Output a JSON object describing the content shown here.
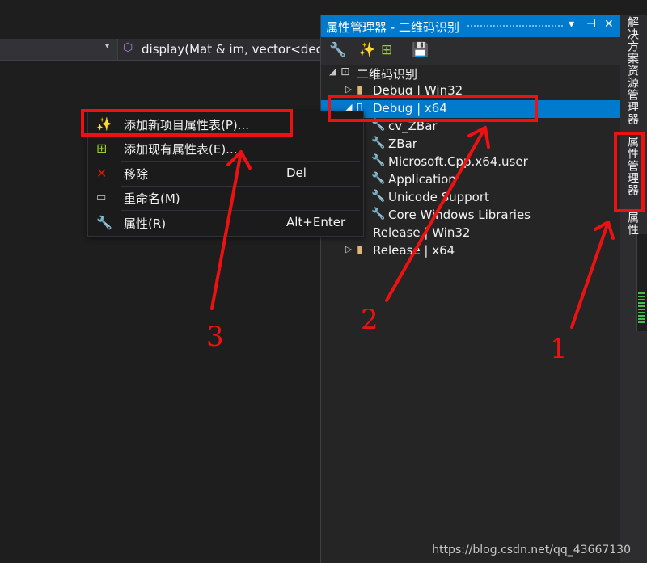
{
  "editor": {
    "nav_function": "display(Mat & im, vector<dec",
    "nav_dropdown_glyph": "▾"
  },
  "panel": {
    "title": "属性管理器 - 二维码识别",
    "pin": "▾",
    "pin2": "⊣",
    "close": "✕",
    "tree": {
      "root": "二维码识别",
      "items": [
        {
          "label": "Debug | Win32"
        },
        {
          "label": "Debug | x64"
        },
        {
          "label": "cv_ZBar"
        },
        {
          "label": "ZBar"
        },
        {
          "label": "Microsoft.Cpp.x64.user"
        },
        {
          "label": "Application"
        },
        {
          "label": "Unicode Support"
        },
        {
          "label": "Core Windows Libraries"
        },
        {
          "label": "Release | Win32"
        },
        {
          "label": "Release | x64"
        }
      ]
    }
  },
  "vtabs": {
    "solution_explorer": "解决方案资源管理器",
    "property_manager": "属性管理器",
    "properties": "属性"
  },
  "context_menu": {
    "add_new": "添加新项目属性表(P)...",
    "add_existing": "添加现有属性表(E)...",
    "remove": "移除",
    "remove_shortcut": "Del",
    "rename": "重命名(M)",
    "properties": "属性(R)",
    "properties_shortcut": "Alt+Enter"
  },
  "annotations": {
    "n1": "1",
    "n2": "2",
    "n3": "3",
    "color": "#ee1111"
  },
  "watermark": "https://blog.csdn.net/qq_43667130",
  "colors": {
    "accent": "#007acc",
    "background": "#1e1e1e",
    "panel": "#252526"
  }
}
